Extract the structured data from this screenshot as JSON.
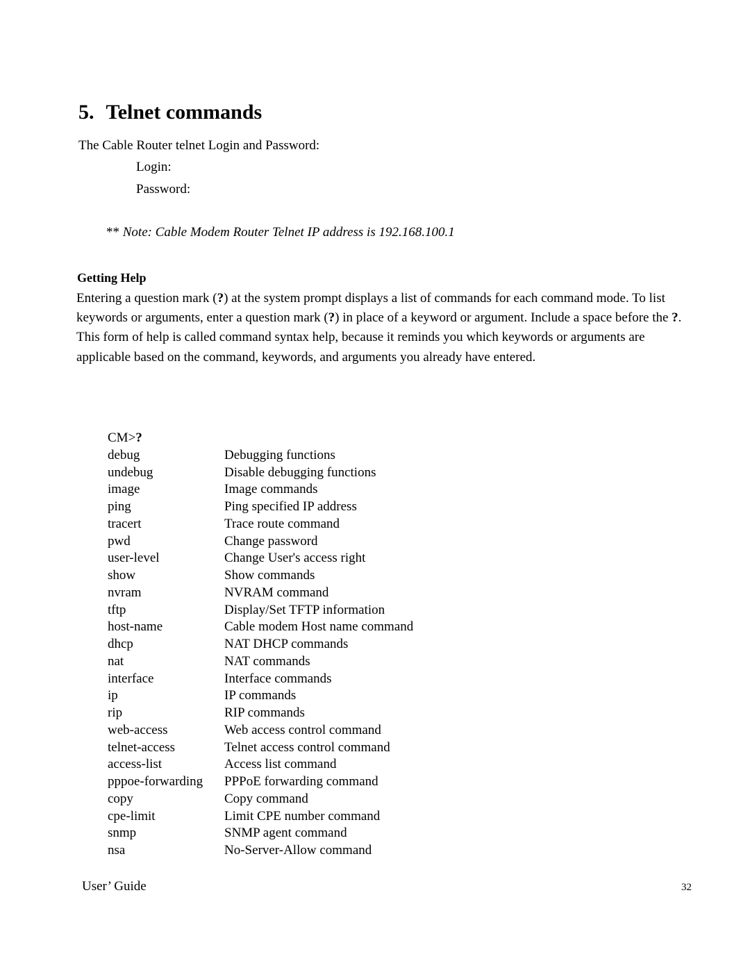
{
  "section": {
    "number": "5.",
    "title": "Telnet commands"
  },
  "intro": "The Cable Router telnet Login and Password:",
  "credentials": {
    "login_label": "Login:",
    "password_label": "Password:"
  },
  "note": {
    "stars": "**",
    "text": "Note:  Cable Modem Router Telnet IP address is 192.168.100.1"
  },
  "getting_help": {
    "heading": "Getting Help",
    "paragraph_parts": [
      "Entering a question mark (",
      "?",
      ") at the system prompt displays a list of commands for each command mode. To list keywords or arguments, enter a question mark (",
      "?",
      ") in place of a keyword or argument. Include a space before the ",
      "?",
      ". This form of help is called command syntax help, because it reminds you which keywords or arguments are applicable based on the command, keywords, and arguments you already have entered."
    ]
  },
  "prompt": {
    "text": "CM>",
    "symbol": "?"
  },
  "commands": [
    {
      "name": "debug",
      "description": "Debugging functions"
    },
    {
      "name": "undebug",
      "description": "Disable debugging functions"
    },
    {
      "name": "image",
      "description": "Image commands"
    },
    {
      "name": "ping",
      "description": "Ping specified IP address"
    },
    {
      "name": "tracert",
      "description": "Trace route command"
    },
    {
      "name": "pwd",
      "description": "Change password"
    },
    {
      "name": "user-level",
      "description": "Change User's access right"
    },
    {
      "name": "show",
      "description": "Show commands"
    },
    {
      "name": "nvram",
      "description": "NVRAM command"
    },
    {
      "name": "tftp",
      "description": "Display/Set TFTP information"
    },
    {
      "name": "host-name",
      "description": "Cable modem Host name command"
    },
    {
      "name": "dhcp",
      "description": "NAT DHCP commands"
    },
    {
      "name": "nat",
      "description": "NAT commands"
    },
    {
      "name": "interface",
      "description": "Interface commands"
    },
    {
      "name": "ip",
      "description": "IP commands"
    },
    {
      "name": "rip",
      "description": "RIP commands"
    },
    {
      "name": "web-access",
      "description": "Web access control command"
    },
    {
      "name": "telnet-access",
      "description": "Telnet access control command"
    },
    {
      "name": "access-list",
      "description": "Access list command"
    },
    {
      "name": "pppoe-forwarding",
      "description": "PPPoE forwarding command"
    },
    {
      "name": "copy",
      "description": "Copy command"
    },
    {
      "name": "cpe-limit",
      "description": "Limit CPE number command"
    },
    {
      "name": "snmp",
      "description": "SNMP agent command"
    },
    {
      "name": "nsa",
      "description": "No-Server-Allow command"
    }
  ],
  "footer": {
    "left": "User’ Guide",
    "page_number": "32"
  }
}
